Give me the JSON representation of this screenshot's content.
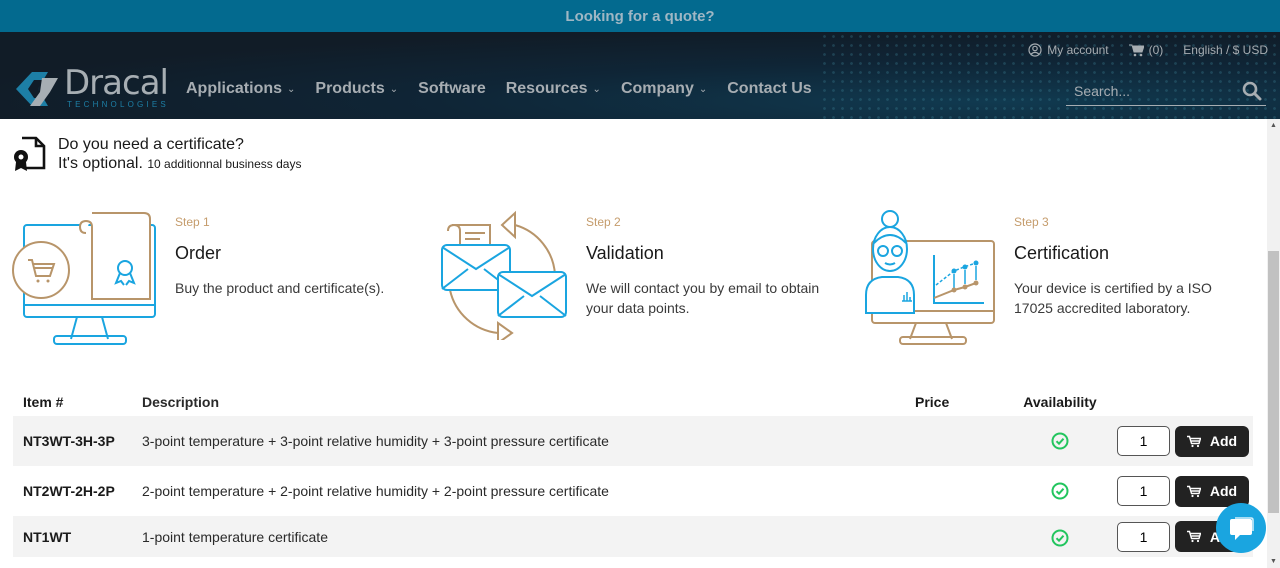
{
  "quote_bar": {
    "text": "Looking for a quote?"
  },
  "header": {
    "logo": {
      "word": "Dracal",
      "sub": "TECHNOLOGIES"
    },
    "nav": [
      {
        "label": "Applications",
        "dropdown": true
      },
      {
        "label": "Products",
        "dropdown": true
      },
      {
        "label": "Software",
        "dropdown": false
      },
      {
        "label": "Resources",
        "dropdown": true
      },
      {
        "label": "Company",
        "dropdown": true
      },
      {
        "label": "Contact Us",
        "dropdown": false
      }
    ],
    "top_links": {
      "account": "My account",
      "cart": "(0)",
      "language": "English / $ USD"
    },
    "search": {
      "placeholder": "Search...",
      "value": ""
    }
  },
  "certificate": {
    "question": "Do you need a certificate?",
    "optional": "It's optional.",
    "extra": "10 additionnal business days"
  },
  "steps": [
    {
      "label": "Step 1",
      "title": "Order",
      "desc": "Buy the product and certificate(s)."
    },
    {
      "label": "Step 2",
      "title": "Validation",
      "desc": "We will contact you by email to obtain your data points."
    },
    {
      "label": "Step 3",
      "title": "Certification",
      "desc": "Your device is certified by a ISO 17025 accredited laboratory."
    }
  ],
  "table": {
    "headers": {
      "item": "Item #",
      "description": "Description",
      "price": "Price",
      "availability": "Availability"
    },
    "rows": [
      {
        "item": "NT3WT-3H-3P",
        "description": "3-point temperature + 3-point relative humidity + 3-point pressure certificate",
        "price": "",
        "available": true,
        "qty": "1",
        "add_label": "Add"
      },
      {
        "item": "NT2WT-2H-2P",
        "description": "2-point temperature + 2-point relative humidity + 2-point pressure certificate",
        "price": "",
        "available": true,
        "qty": "1",
        "add_label": "Add"
      },
      {
        "item": "NT1WT",
        "description": "1-point temperature certificate",
        "price": "",
        "available": true,
        "qty": "1",
        "add_label": "Add"
      }
    ]
  },
  "colors": {
    "accent_blue": "#1aa5e0",
    "accent_gold": "#c59c6c",
    "available_green": "#22c55e",
    "quote_bar": "#036a8f"
  }
}
